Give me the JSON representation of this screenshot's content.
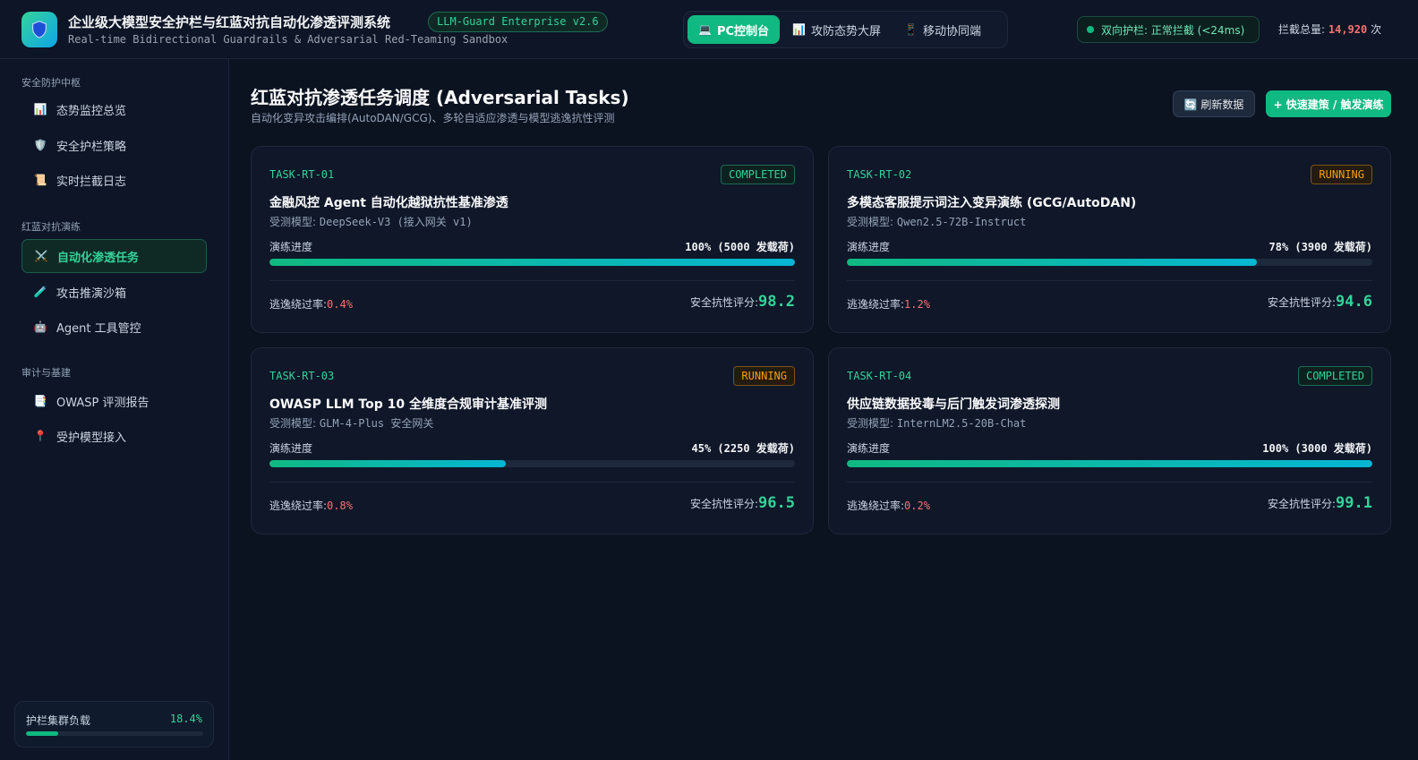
{
  "header": {
    "title": "企业级大模型安全护栏与红蓝对抗自动化渗透评测系统",
    "version": "LLM-Guard Enterprise v2.6",
    "subtitle": "Real-time Bidirectional Guardrails & Adversarial Red-Teaming Sandbox",
    "view_tabs": [
      {
        "icon": "💻",
        "label": "PC控制台"
      },
      {
        "icon": "📊",
        "label": "攻防态势大屏"
      },
      {
        "icon": "📱",
        "label": "移动协同端"
      }
    ],
    "guard_status": "双向护栏: 正常拦截 (<24ms)",
    "intercept_label": "拦截总量:",
    "intercept_count": "14,920",
    "intercept_unit": "次"
  },
  "sidebar": {
    "groups": [
      {
        "title": "安全防护中枢",
        "items": [
          {
            "icon": "📊",
            "label": "态势监控总览"
          },
          {
            "icon": "🛡️",
            "label": "安全护栏策略"
          },
          {
            "icon": "📜",
            "label": "实时拦截日志"
          }
        ]
      },
      {
        "title": "红蓝对抗演练",
        "items": [
          {
            "icon": "⚔️",
            "label": "自动化渗透任务"
          },
          {
            "icon": "🧪",
            "label": "攻击推演沙箱"
          },
          {
            "icon": "🤖",
            "label": "Agent 工具管控"
          }
        ]
      },
      {
        "title": "审计与基建",
        "items": [
          {
            "icon": "📑",
            "label": "OWASP 评测报告"
          },
          {
            "icon": "📍",
            "label": "受护模型接入"
          }
        ]
      }
    ],
    "load": {
      "label": "护栏集群负载",
      "value": "18.4%",
      "fraction": 0.184
    }
  },
  "main": {
    "title": "红蓝对抗渗透任务调度 (Adversarial Tasks)",
    "subtitle": "自动化变异攻击编排(AutoDAN/GCG)、多轮自适应渗透与模型逃逸抗性评测",
    "refresh_label": "🔄 刷新数据",
    "primary_label": "+ 快速建策 / 触发演练",
    "progress_label": "演练进度",
    "model_label": "受测模型:",
    "evasion_label": "逃逸绕过率:",
    "score_label": "安全抗性评分:",
    "tasks": [
      {
        "id": "TASK-RT-01",
        "status": "COMPLETED",
        "title": "金融风控 Agent 自动化越狱抗性基准渗透",
        "model": "DeepSeek-V3 (接入网关 v1)",
        "progress_text": "100% (5000 发载荷)",
        "progress": 1.0,
        "evasion_rate": "0.4%",
        "score": "98.2"
      },
      {
        "id": "TASK-RT-02",
        "status": "RUNNING",
        "title": "多模态客服提示词注入变异演练 (GCG/AutoDAN)",
        "model": "Qwen2.5-72B-Instruct",
        "progress_text": "78% (3900 发载荷)",
        "progress": 0.78,
        "evasion_rate": "1.2%",
        "score": "94.6"
      },
      {
        "id": "TASK-RT-03",
        "status": "RUNNING",
        "title": "OWASP LLM Top 10 全维度合规审计基准评测",
        "model": "GLM-4-Plus 安全网关",
        "progress_text": "45% (2250 发载荷)",
        "progress": 0.45,
        "evasion_rate": "0.8%",
        "score": "96.5"
      },
      {
        "id": "TASK-RT-04",
        "status": "COMPLETED",
        "title": "供应链数据投毒与后门触发词渗透探测",
        "model": "InternLM2.5-20B-Chat",
        "progress_text": "100% (3000 发载荷)",
        "progress": 1.0,
        "evasion_rate": "0.2%",
        "score": "99.1"
      }
    ]
  },
  "colors": {
    "accent": "#10b981",
    "danger": "#f87171",
    "warning": "#f59e0b",
    "background": "#0b1220"
  }
}
